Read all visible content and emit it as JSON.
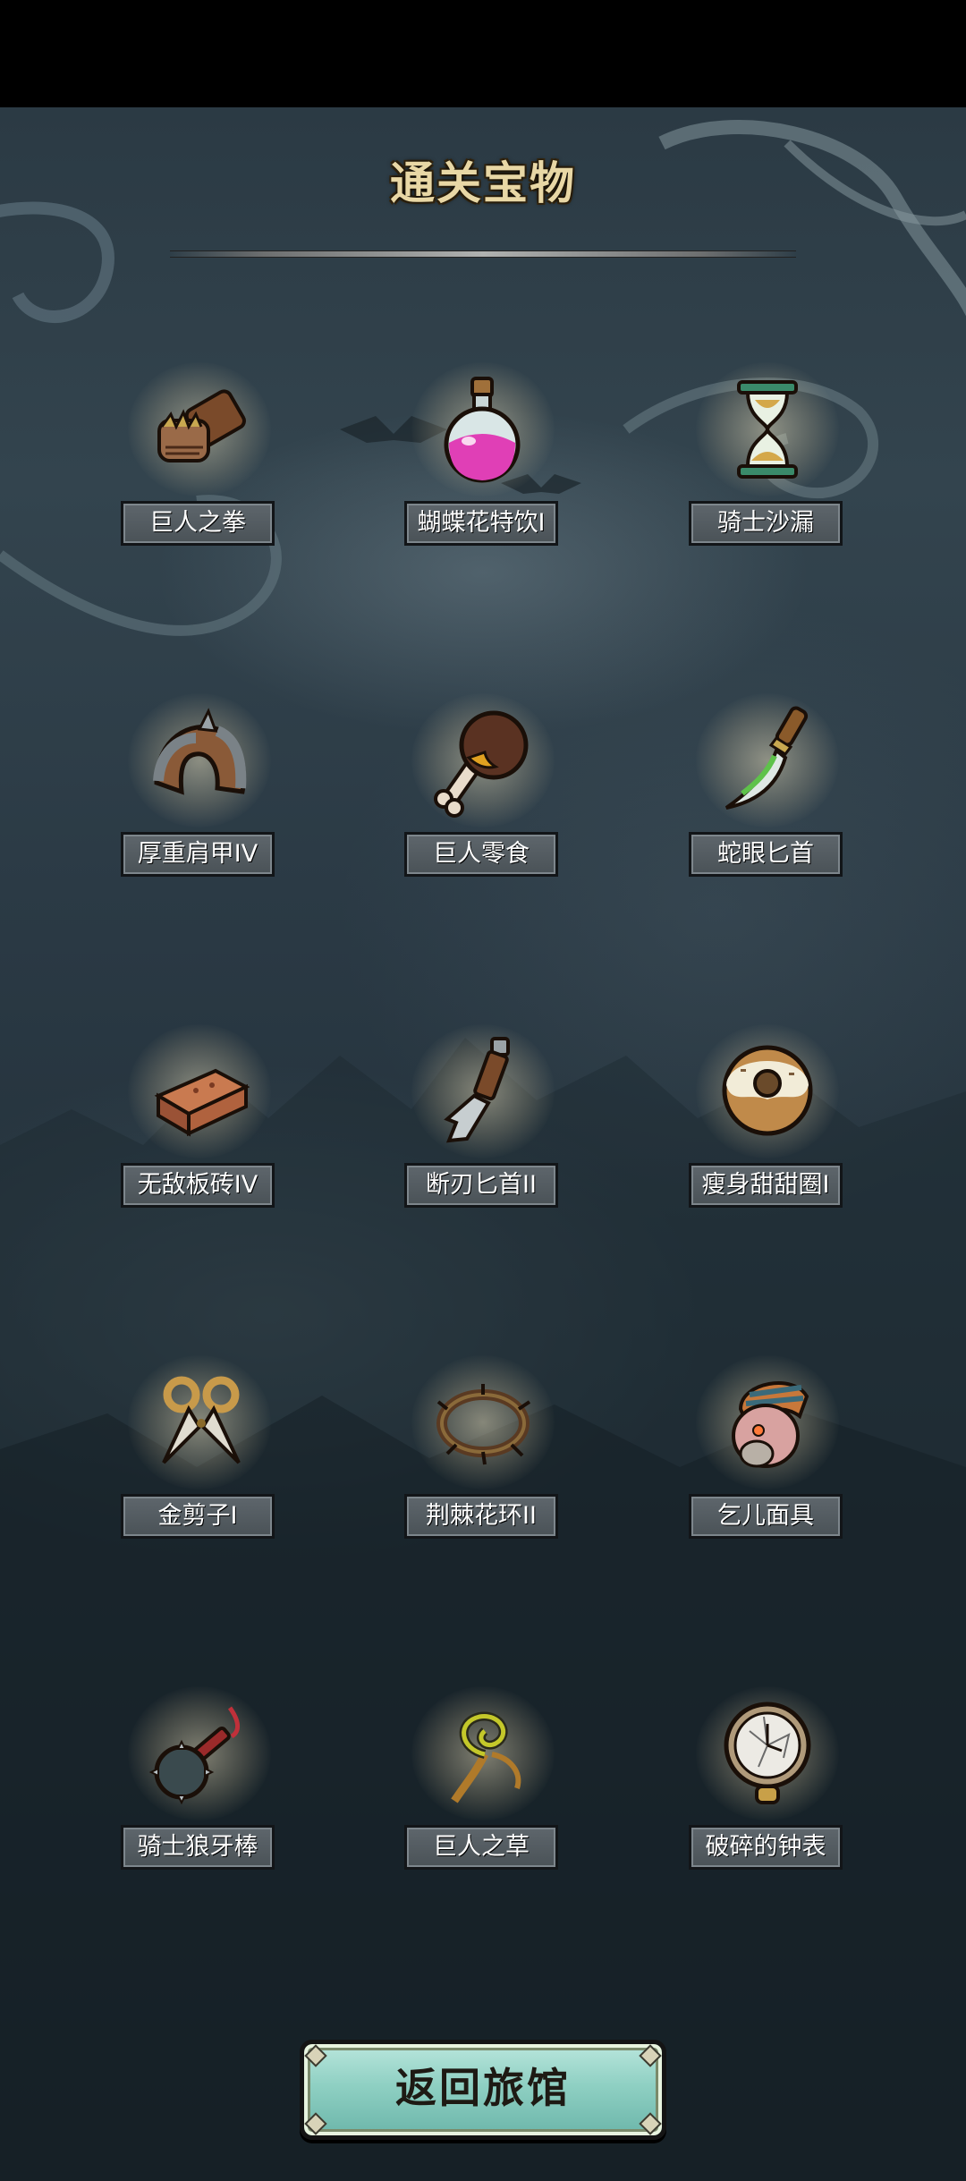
{
  "screen": {
    "title": "通关宝物",
    "return_button_label": "返回旅馆"
  },
  "items": [
    {
      "label": "巨人之拳",
      "icon": "giant-fist-icon"
    },
    {
      "label": "蝴蝶花特饮I",
      "icon": "pink-potion-icon"
    },
    {
      "label": "骑士沙漏",
      "icon": "hourglass-icon"
    },
    {
      "label": "厚重肩甲IV",
      "icon": "shoulder-armor-icon"
    },
    {
      "label": "巨人零食",
      "icon": "bone-meat-icon"
    },
    {
      "label": "蛇眼匕首",
      "icon": "curved-dagger-icon"
    },
    {
      "label": "无敌板砖IV",
      "icon": "brick-icon"
    },
    {
      "label": "断刃匕首II",
      "icon": "broken-dagger-icon"
    },
    {
      "label": "瘦身甜甜圈I",
      "icon": "donut-icon"
    },
    {
      "label": "金剪子I",
      "icon": "golden-scissors-icon"
    },
    {
      "label": "荆棘花环II",
      "icon": "thorn-wreath-icon"
    },
    {
      "label": "乞儿面具",
      "icon": "beggar-mask-icon"
    },
    {
      "label": "骑士狼牙棒",
      "icon": "mace-icon"
    },
    {
      "label": "巨人之草",
      "icon": "herb-icon"
    },
    {
      "label": "破碎的钟表",
      "icon": "broken-pocket-watch-icon"
    }
  ],
  "colors": {
    "title": "#e8d7a5",
    "button": "#8fd0c3",
    "label_bg": "#545c62"
  }
}
